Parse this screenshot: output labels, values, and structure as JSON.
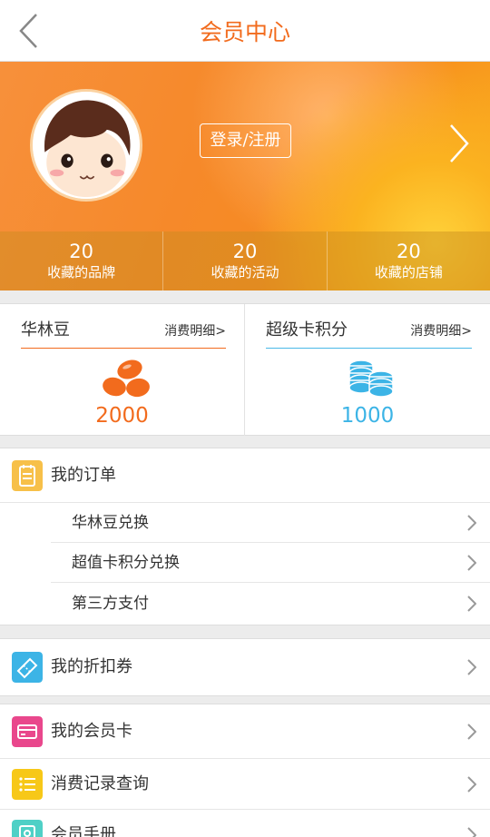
{
  "header": {
    "title": "会员中心",
    "back_icon": "chevron-left-icon"
  },
  "banner": {
    "login_label": "登录/注册",
    "stats": [
      {
        "value": "20",
        "label": "收藏的品牌"
      },
      {
        "value": "20",
        "label": "收藏的活动"
      },
      {
        "value": "20",
        "label": "收藏的店铺"
      }
    ]
  },
  "assets": {
    "beans": {
      "title": "华林豆",
      "link": "消费明细>",
      "value": "2000",
      "icon": "beans-icon",
      "color": "#f26b1d"
    },
    "points": {
      "title": "超级卡积分",
      "link": "消费明细>",
      "value": "1000",
      "icon": "coin-stack-icon",
      "color": "#3cb4e6"
    }
  },
  "orders": {
    "title": "我的订单",
    "items": [
      {
        "label": "华林豆兑换"
      },
      {
        "label": "超值卡积分兑换"
      },
      {
        "label": "第三方支付"
      }
    ]
  },
  "menu": {
    "coupons": "我的折扣券",
    "member_card": "我的会员卡",
    "records": "消费记录查询",
    "handbook": "会员手册"
  },
  "colors": {
    "accent": "#f26b1d",
    "blue": "#3cb4e6",
    "order_icon": "#f7c049",
    "coupon_icon": "#3cb4e6",
    "card_icon": "#e9478c",
    "record_icon": "#f7c818",
    "handbook_icon": "#4fd0c6"
  }
}
